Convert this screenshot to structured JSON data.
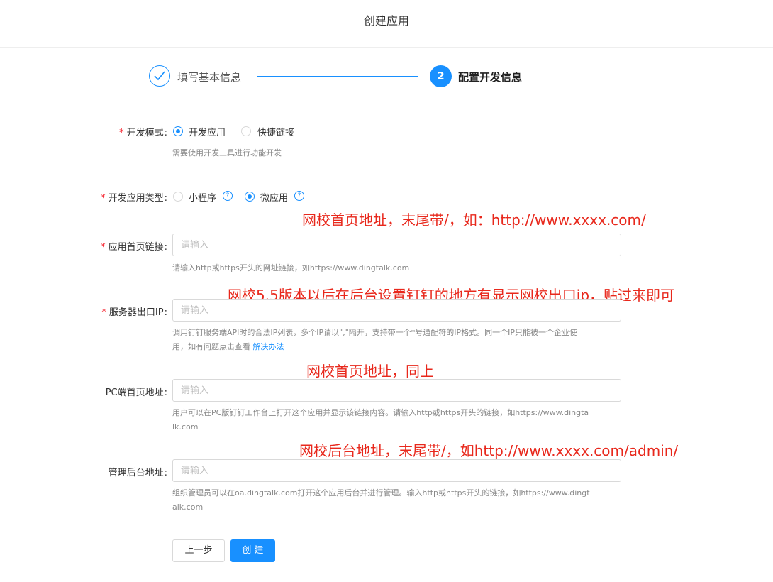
{
  "page": {
    "title": "创建应用"
  },
  "steps": [
    {
      "label": "填写基本信息",
      "status": "done"
    },
    {
      "number": "2",
      "label": "配置开发信息",
      "status": "active"
    }
  ],
  "form": {
    "dev_mode": {
      "label": "开发模式",
      "options": [
        {
          "label": "开发应用",
          "selected": true
        },
        {
          "label": "快捷链接",
          "selected": false
        }
      ],
      "hint": "需要使用开发工具进行功能开发"
    },
    "app_type": {
      "label": "开发应用类型",
      "options": [
        {
          "label": "小程序",
          "selected": false
        },
        {
          "label": "微应用",
          "selected": true
        }
      ]
    },
    "home_link": {
      "label": "应用首页链接",
      "placeholder": "请输入",
      "hint": "请输入http或https开头的网址链接，如https://www.dingtalk.com"
    },
    "server_ip": {
      "label": "服务器出口IP",
      "placeholder": "请输入",
      "hint_line1": "调用钉钉服务端API时的合法IP列表，多个IP请以\",\"隔开，支持带一个*号通配符的IP格式。同一个IP只能被一个企业使",
      "hint_line2": "用，如有问题点击查看",
      "hint_link": "解决办法"
    },
    "pc_home": {
      "label": "PC端首页地址",
      "placeholder": "请输入",
      "hint_line1": "用户可以在PC版钉钉工作台上打开这个应用并显示该链接内容。请输入http或https开头的链接，如https://www.dingta",
      "hint_line2": "lk.com"
    },
    "admin_url": {
      "label": "管理后台地址",
      "placeholder": "请输入",
      "hint_line1": "组织管理员可以在oa.dingtalk.com打开这个应用后台并进行管理。输入http或https开头的链接，如https://www.dingt",
      "hint_line2": "alk.com"
    }
  },
  "annotations": {
    "a1": "网校首页地址，末尾带/，如：http://www.xxxx.com/",
    "a2": "网校5.5版本以后在后台设置钉钉的地方有显示网校出口ip，贴过来即可",
    "a3": "网校首页地址，同上",
    "a4": "网校后台地址，末尾带/，如http://www.xxxx.com/admin/"
  },
  "buttons": {
    "prev": "上一步",
    "create": "创 建"
  },
  "colors": {
    "primary": "#1890ff",
    "required": "#f5222d",
    "annotation": "#e8281c"
  }
}
